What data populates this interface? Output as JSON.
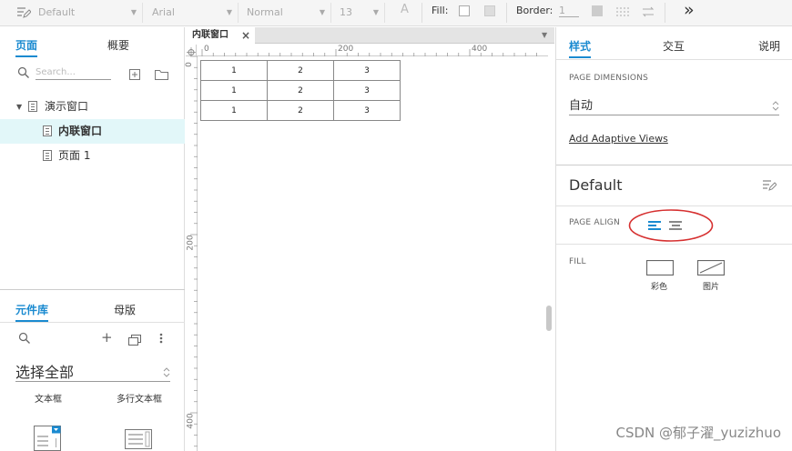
{
  "toolbar": {
    "style_select": "Default",
    "font_select": "Arial",
    "weight_select": "Normal",
    "size_select": "13",
    "fill_label": "Fill:",
    "border_label": "Border:",
    "border_value": "1",
    "more_label": "»"
  },
  "left_panel": {
    "tabs": [
      "页面",
      "概要"
    ],
    "search_placeholder": "Search...",
    "tree": [
      {
        "label": "演示窗口",
        "level": 0,
        "selected": false
      },
      {
        "label": "内联窗口",
        "level": 1,
        "selected": true
      },
      {
        "label": "页面 1",
        "level": 1,
        "selected": false
      }
    ],
    "lib_tabs": [
      "元件库",
      "母版"
    ],
    "lib_select": "选择全部",
    "widgets": [
      "文本框",
      "多行文本框"
    ]
  },
  "canvas": {
    "doc_tab": "内联窗口",
    "close_glyph": "×",
    "ruler_h": [
      "0",
      "200",
      "400"
    ],
    "ruler_v": [
      "0",
      "200",
      "400"
    ],
    "table_rows": [
      [
        "1",
        "2",
        "3"
      ],
      [
        "1",
        "2",
        "3"
      ],
      [
        "1",
        "2",
        "3"
      ]
    ]
  },
  "right_panel": {
    "tabs": [
      "样式",
      "交互",
      "说明"
    ],
    "page_dimensions_label": "PAGE DIMENSIONS",
    "dimension_value": "自动",
    "adaptive_link": "Add Adaptive Views",
    "style_name": "Default",
    "page_align_label": "PAGE ALIGN",
    "fill_label": "FILL",
    "fill_color_label": "彩色",
    "fill_image_label": "图片"
  },
  "watermark": "CSDN @郁子濯_yuzizhuo",
  "colors": {
    "accent": "#1a8ad0",
    "selected_bg": "#e2f7f9",
    "annotation": "#d63030"
  }
}
